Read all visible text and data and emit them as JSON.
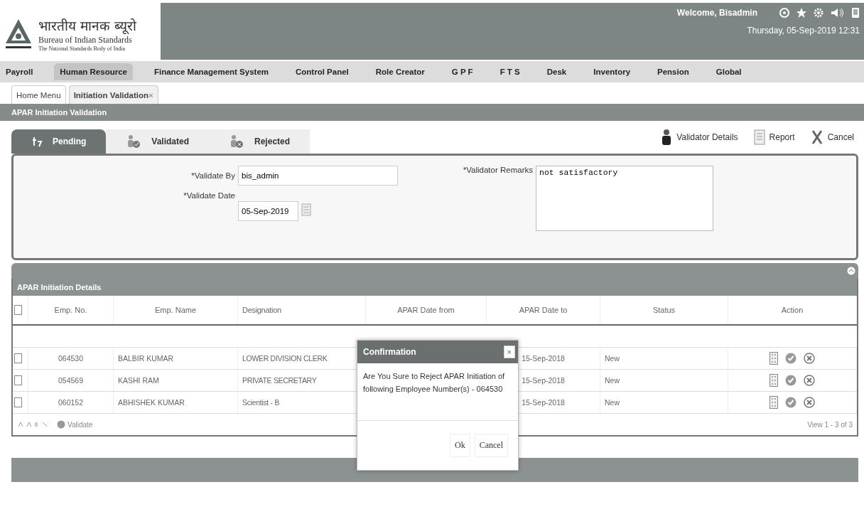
{
  "header": {
    "org_hindi": "भारतीय मानक ब्यूरो",
    "org_name": "Bureau of Indian Standards",
    "org_tagline": "The National Standards Body of India",
    "welcome": "Welcome, Bisadmin",
    "datetime": "Thursday, 05-Sep-2019 12:31"
  },
  "nav": [
    {
      "label": "Payroll",
      "selected": false
    },
    {
      "label": "Human Resource",
      "selected": true
    },
    {
      "label": "Finance Management System",
      "selected": false
    },
    {
      "label": "Control Panel",
      "selected": false
    },
    {
      "label": "Role Creator",
      "selected": false
    },
    {
      "label": "G P F",
      "selected": false
    },
    {
      "label": "F T S",
      "selected": false
    },
    {
      "label": "Desk",
      "selected": false
    },
    {
      "label": "Inventory",
      "selected": false
    },
    {
      "label": "Pension",
      "selected": false
    },
    {
      "label": "Global",
      "selected": false
    }
  ],
  "breadcrumb_tabs": [
    {
      "label": "Home Menu",
      "selected": false
    },
    {
      "label": "Initiation Validation",
      "selected": true,
      "close": "×"
    }
  ],
  "panel_title": "APAR Initiation Validation",
  "status_tabs": [
    {
      "label": "Pending",
      "kind": "pending",
      "selected": true
    },
    {
      "label": "Validated",
      "kind": "validated",
      "selected": false
    },
    {
      "label": "Rejected",
      "kind": "rejected",
      "selected": false
    }
  ],
  "toolbar": [
    {
      "label": "Validator Details",
      "kind": "person"
    },
    {
      "label": "Report",
      "kind": "report"
    },
    {
      "label": "Cancel",
      "kind": "cancel"
    }
  ],
  "form": {
    "validate_by": {
      "label": "*Validate By",
      "value": "bis_admin"
    },
    "validate_date": {
      "label": "*Validate Date",
      "value": "05-Sep-2019"
    },
    "remarks": {
      "label": "*Validator Remarks",
      "value": "not satisfactory"
    }
  },
  "grid": {
    "title": "APAR Initiation Details",
    "header_checked": false,
    "columns": [
      "Emp. No.",
      "Emp. Name",
      "Designation",
      "APAR Date from",
      "APAR Date to",
      "Status",
      "Action"
    ],
    "rows": [
      {
        "checked": false,
        "emp_no": "064530",
        "emp_name": "BALBIR KUMAR",
        "designation": "LOWER DIVISION CLERK",
        "date_to": "15-Sep-2018",
        "status": "New"
      },
      {
        "checked": false,
        "emp_no": "054569",
        "emp_name": "KASHI RAM",
        "designation": "PRIVATE SECRETARY",
        "date_to": "15-Sep-2018",
        "status": "New"
      },
      {
        "checked": false,
        "emp_no": "060152",
        "emp_name": "ABHISHEK KUMAR",
        "designation": "Scientist - B",
        "date_to": "15-Sep-2018",
        "status": "New"
      }
    ],
    "pager_button": "Validate",
    "pager_info": "View 1 - 3 of 3"
  },
  "dialog": {
    "title": "Confirmation",
    "close": "×",
    "message": "Are You Sure to Reject APAR Initiation of following Employee Number(s) - 064530",
    "buttons": [
      "Ok",
      "Cancel"
    ]
  }
}
